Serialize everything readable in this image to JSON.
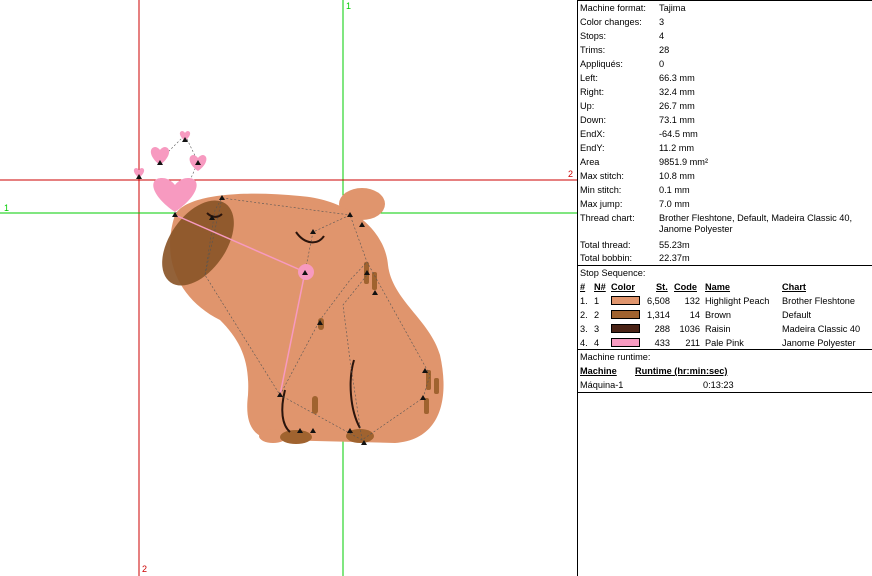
{
  "guides": {
    "vertical_top_label": "1",
    "vertical_bottom_label": "2",
    "horizontal_left_label": "1",
    "horizontal_right_label": "2"
  },
  "colors": {
    "guide_red": "#cc0000",
    "guide_green": "#00cc00",
    "body": "#e0956d",
    "brown": "#a0632f",
    "raisin": "#4a2316",
    "pink": "#f79ac0"
  },
  "info": {
    "rows": [
      {
        "label": "Machine format:",
        "value": "Tajima"
      },
      {
        "label": "Color changes:",
        "value": "3"
      },
      {
        "label": "Stops:",
        "value": "4"
      },
      {
        "label": "Trims:",
        "value": "28"
      },
      {
        "label": "Appliqués:",
        "value": "0"
      },
      {
        "label": "Left:",
        "value": "66.3 mm"
      },
      {
        "label": "Right:",
        "value": "32.4 mm"
      },
      {
        "label": "Up:",
        "value": "26.7 mm"
      },
      {
        "label": "Down:",
        "value": "73.1 mm"
      },
      {
        "label": "EndX:",
        "value": "-64.5 mm"
      },
      {
        "label": "EndY:",
        "value": "11.2 mm"
      },
      {
        "label": "Area",
        "value": "9851.9 mm²"
      },
      {
        "label": "Max stitch:",
        "value": "10.8 mm"
      },
      {
        "label": "Min stitch:",
        "value": "0.1 mm"
      },
      {
        "label": "Max jump:",
        "value": "7.0 mm"
      }
    ],
    "thread_chart_label": "Thread chart:",
    "thread_chart_value": "Brother Fleshtone, Default, Madeira Classic 40, Janome Polyester",
    "total_thread_label": "Total thread:",
    "total_thread_value": "55.23m",
    "total_bobbin_label": "Total bobbin:",
    "total_bobbin_value": "22.37m"
  },
  "stop_sequence": {
    "title": "Stop Sequence:",
    "headers": {
      "num": "#",
      "n_num": "N#",
      "color": "Color",
      "st": "St.",
      "code": "Code",
      "name": "Name",
      "chart": "Chart"
    },
    "rows": [
      {
        "num": "1.",
        "n": "1",
        "color": "#e0956d",
        "st": "6,508",
        "code": "132",
        "name": "Highlight Peach",
        "chart": "Brother Fleshtone"
      },
      {
        "num": "2.",
        "n": "2",
        "color": "#a0632f",
        "st": "1,314",
        "code": "14",
        "name": "Brown",
        "chart": "Default"
      },
      {
        "num": "3.",
        "n": "3",
        "color": "#4a2316",
        "st": "288",
        "code": "1036",
        "name": "Raisin",
        "chart": "Madeira Classic 40"
      },
      {
        "num": "4.",
        "n": "4",
        "color": "#f79ac0",
        "st": "433",
        "code": "211",
        "name": "Pale Pink",
        "chart": "Janome Polyester"
      }
    ]
  },
  "runtime": {
    "title": "Machine runtime:",
    "header_machine": "Machine",
    "header_runtime": "Runtime (hr:min:sec)",
    "machine": "Máquina-1",
    "value": "0:13:23"
  }
}
